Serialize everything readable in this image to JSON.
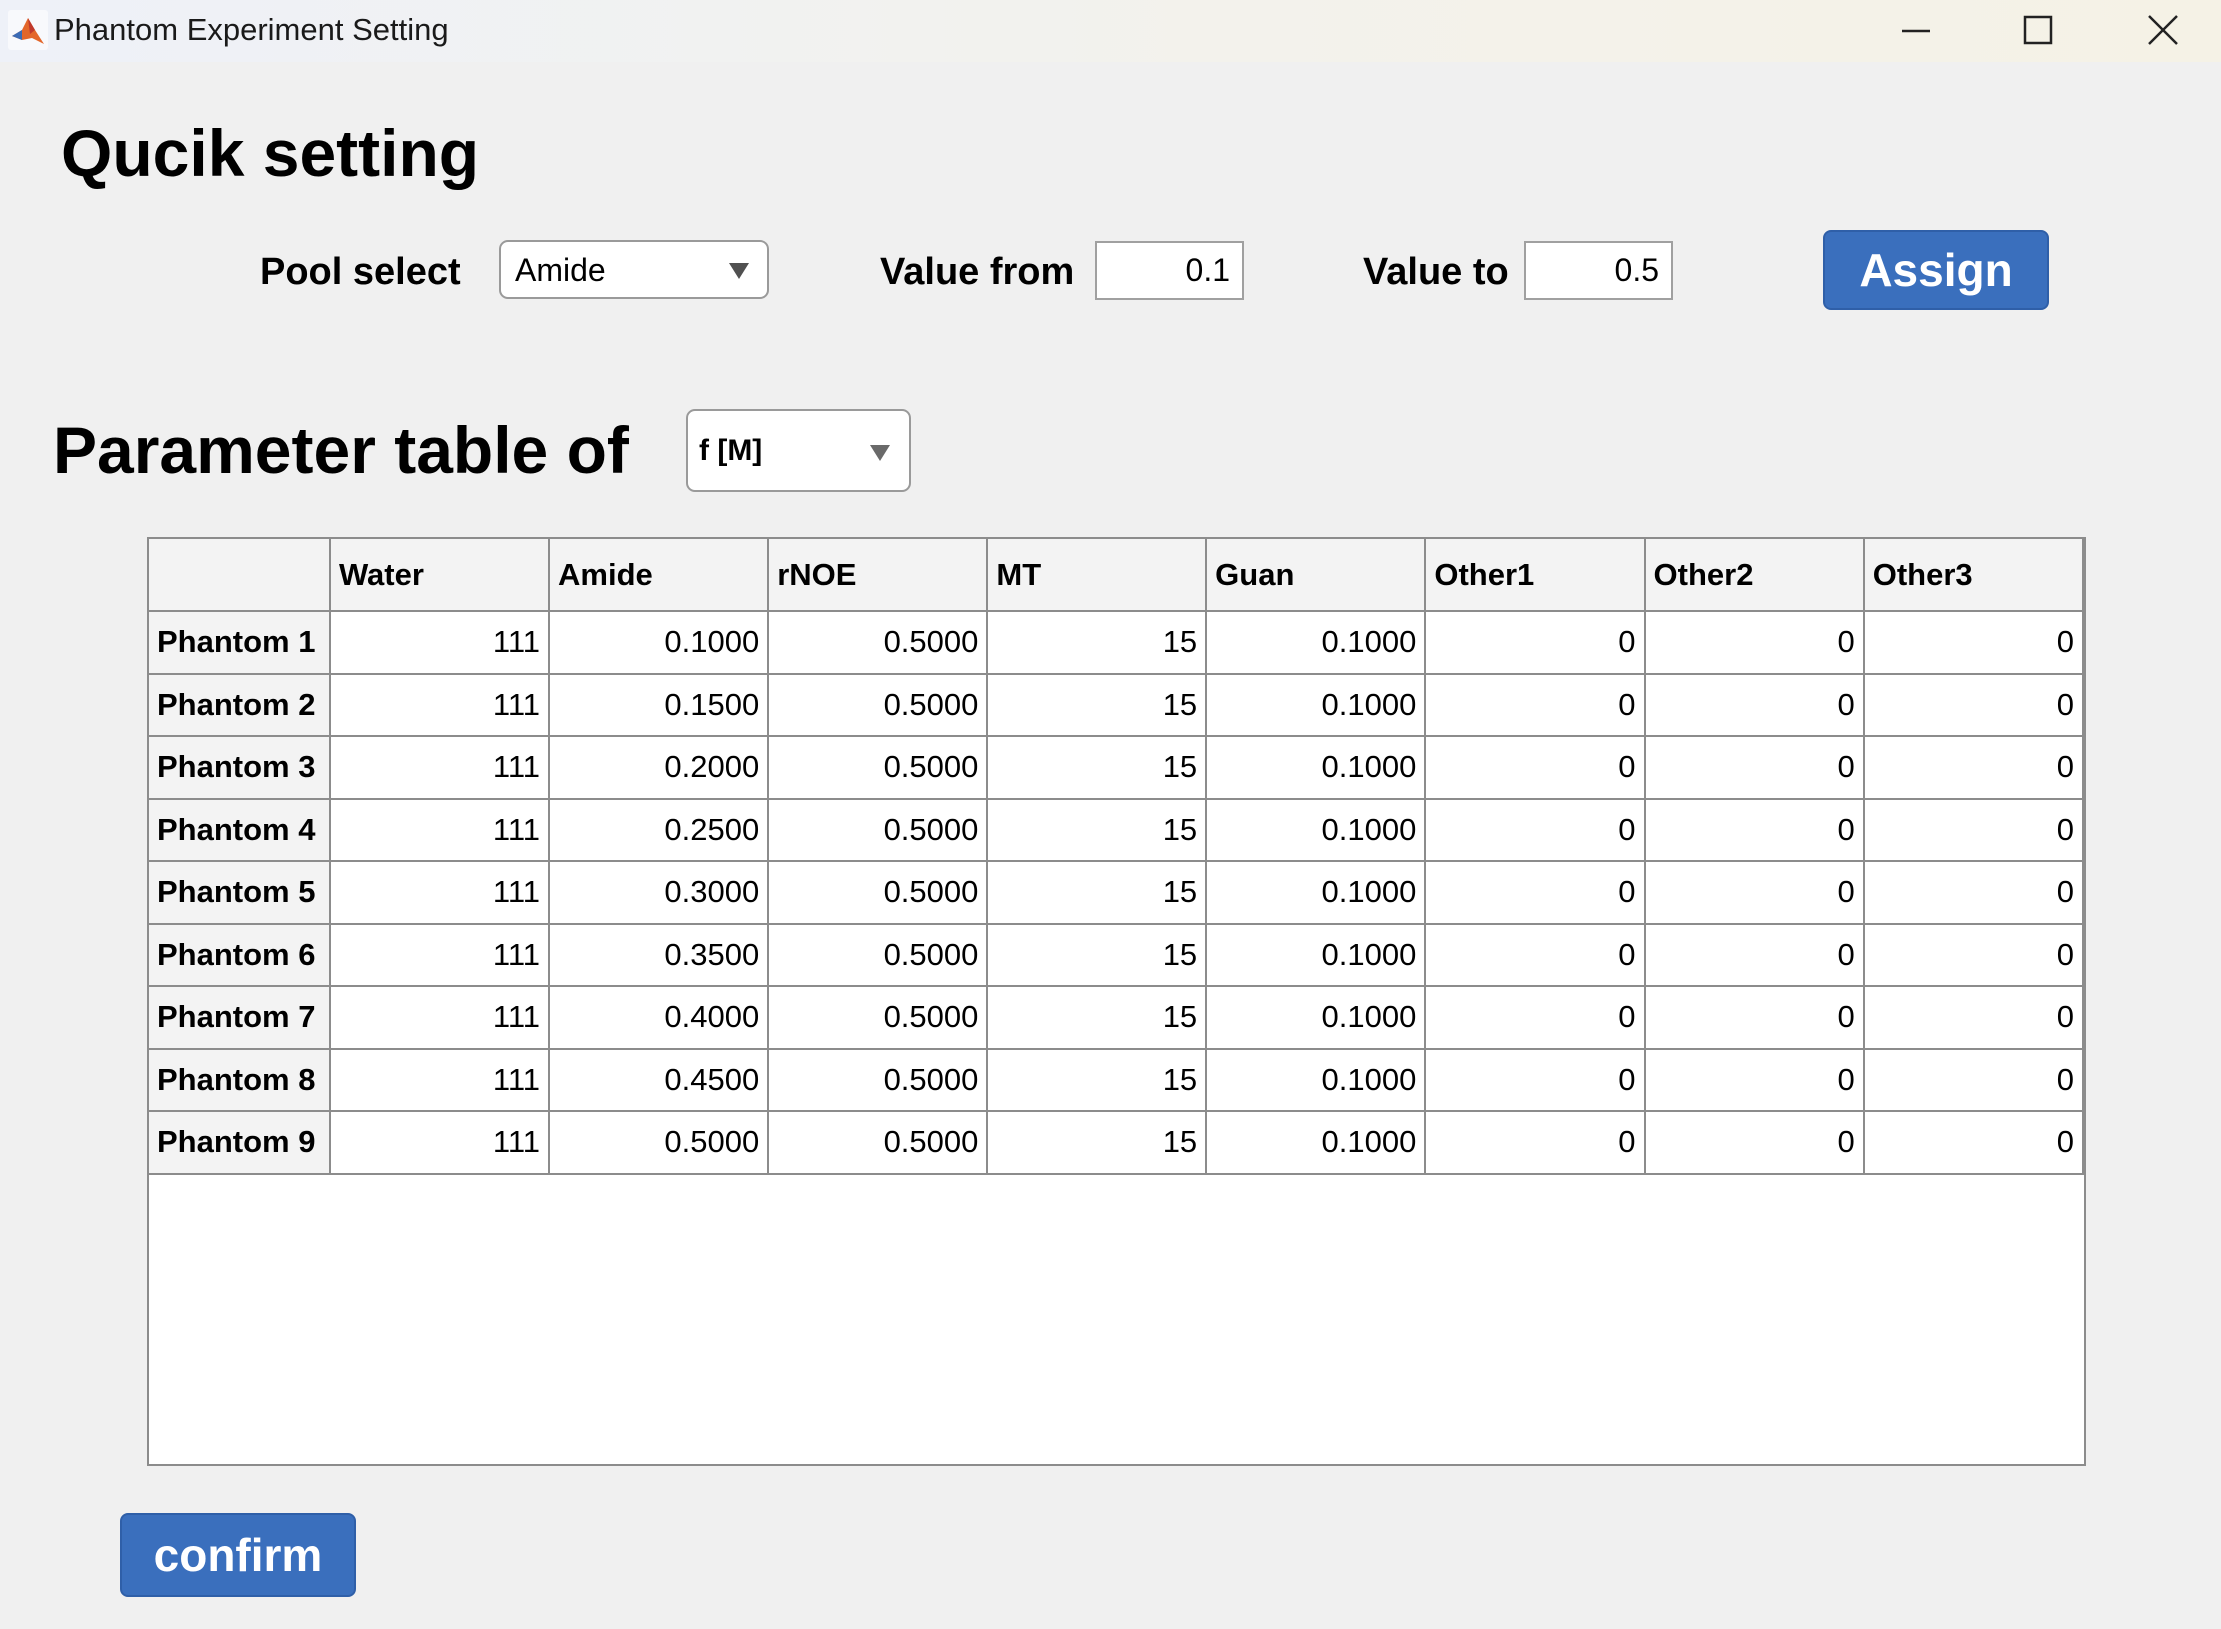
{
  "window": {
    "title": "Phantom Experiment Setting",
    "icon": "matlab-icon",
    "controls": [
      "minimize-icon",
      "maximize-icon",
      "close-icon"
    ]
  },
  "quick_setting": {
    "heading": "Qucik setting",
    "pool_select_label": "Pool select",
    "pool_select_value": "Amide",
    "value_from_label": "Value from",
    "value_from": "0.1",
    "value_to_label": "Value to",
    "value_to": "0.5",
    "assign_label": "Assign"
  },
  "parameter_table": {
    "heading": "Parameter table of",
    "parameter_select_value": "f [M]",
    "columns": [
      "",
      "Water",
      "Amide",
      "rNOE",
      "MT",
      "Guan",
      "Other1",
      "Other2",
      "Other3"
    ],
    "rows": [
      {
        "label": "Phantom 1",
        "values": [
          "111",
          "0.1000",
          "0.5000",
          "15",
          "0.1000",
          "0",
          "0",
          "0"
        ]
      },
      {
        "label": "Phantom 2",
        "values": [
          "111",
          "0.1500",
          "0.5000",
          "15",
          "0.1000",
          "0",
          "0",
          "0"
        ]
      },
      {
        "label": "Phantom 3",
        "values": [
          "111",
          "0.2000",
          "0.5000",
          "15",
          "0.1000",
          "0",
          "0",
          "0"
        ]
      },
      {
        "label": "Phantom 4",
        "values": [
          "111",
          "0.2500",
          "0.5000",
          "15",
          "0.1000",
          "0",
          "0",
          "0"
        ]
      },
      {
        "label": "Phantom 5",
        "values": [
          "111",
          "0.3000",
          "0.5000",
          "15",
          "0.1000",
          "0",
          "0",
          "0"
        ]
      },
      {
        "label": "Phantom 6",
        "values": [
          "111",
          "0.3500",
          "0.5000",
          "15",
          "0.1000",
          "0",
          "0",
          "0"
        ]
      },
      {
        "label": "Phantom 7",
        "values": [
          "111",
          "0.4000",
          "0.5000",
          "15",
          "0.1000",
          "0",
          "0",
          "0"
        ]
      },
      {
        "label": "Phantom 8",
        "values": [
          "111",
          "0.4500",
          "0.5000",
          "15",
          "0.1000",
          "0",
          "0",
          "0"
        ]
      },
      {
        "label": "Phantom 9",
        "values": [
          "111",
          "0.5000",
          "0.5000",
          "15",
          "0.1000",
          "0",
          "0",
          "0"
        ]
      }
    ]
  },
  "confirm_label": "confirm",
  "colors": {
    "button_blue": "#3a6fbd",
    "background": "#f0f0f0"
  }
}
